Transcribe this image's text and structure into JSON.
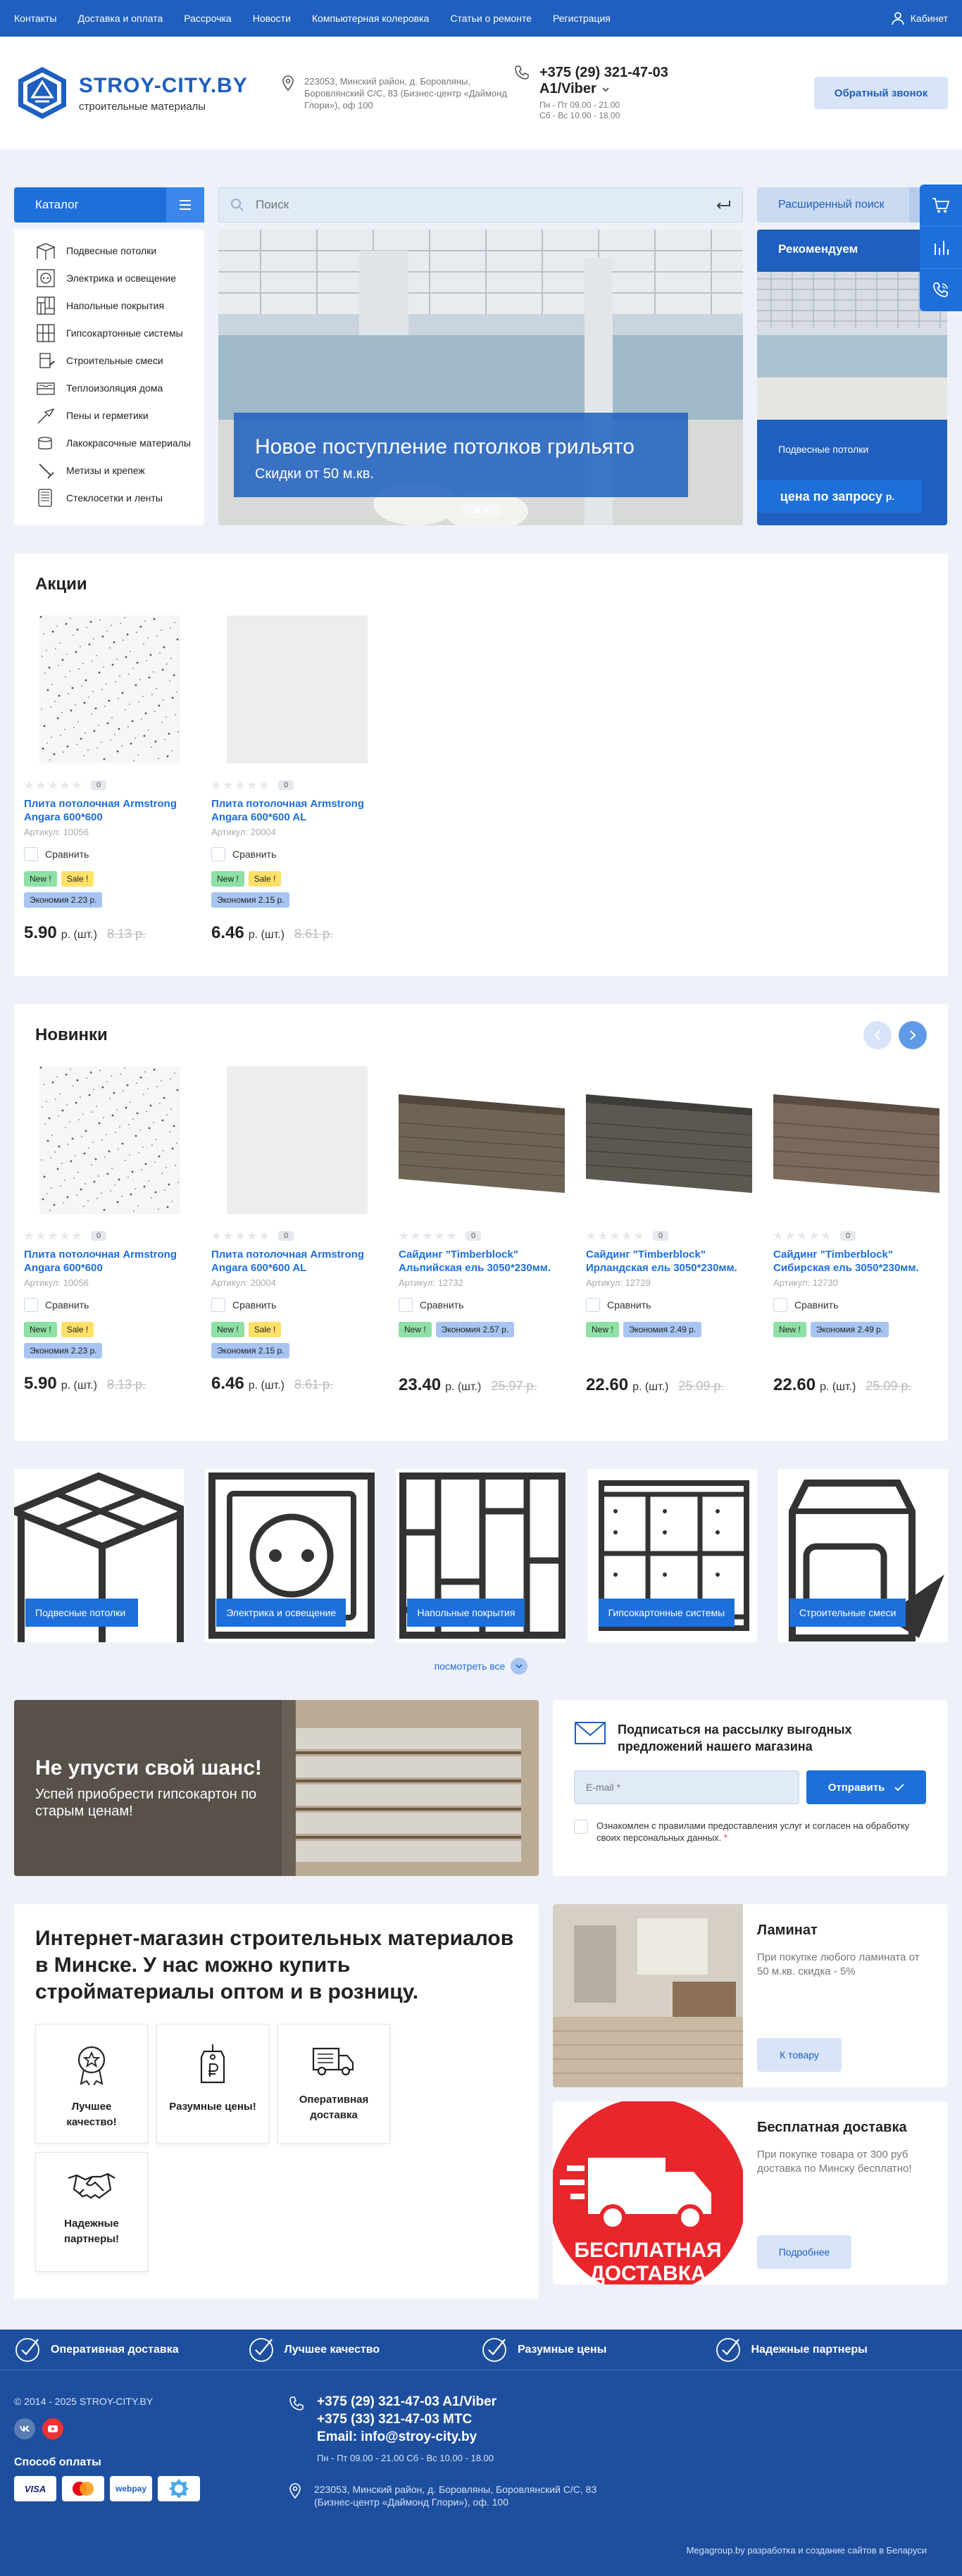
{
  "topbar": {
    "links": [
      "Контакты",
      "Доставка и оплата",
      "Рассрочка",
      "Новости",
      "Компьютерная колеровка",
      "Статьи о ремонте",
      "Регистрация"
    ],
    "cabinet": "Кабинет"
  },
  "header": {
    "logo_title": "STROY-CITY.BY",
    "logo_sub": "строительные материалы",
    "address": "223053, Минский район, д. Боровляны, Боровлянский С/С, 83 (Бизнес-центр «Даймонд Глори»), оф 100",
    "phone": "+375 (29) 321-47-03",
    "phone_sub": "A1/Viber",
    "hours_1": "Пн - Пт 09.00 - 21.00",
    "hours_2": "Сб - Вс 10.00 - 18.00",
    "callback": "Обратный звонок"
  },
  "search": {
    "catalog": "Каталог",
    "placeholder": "Поиск",
    "advanced": "Расширенный поиск"
  },
  "catalog_items": [
    {
      "label": "Подвесные потолки",
      "icon": "ceiling-icon"
    },
    {
      "label": "Электрика и освещение",
      "icon": "socket-icon"
    },
    {
      "label": "Напольные покрытия",
      "icon": "floor-icon"
    },
    {
      "label": "Гипсокартонные системы",
      "icon": "drywall-icon"
    },
    {
      "label": "Строительные смеси",
      "icon": "mix-icon"
    },
    {
      "label": "Теплоизоляция дома",
      "icon": "insulation-icon"
    },
    {
      "label": "Пены и герметики",
      "icon": "foam-icon"
    },
    {
      "label": "Лакокрасочные материалы",
      "icon": "paint-icon"
    },
    {
      "label": "Метизы и крепеж",
      "icon": "hardware-icon"
    },
    {
      "label": "Стеклосетки и ленты",
      "icon": "mesh-icon"
    }
  ],
  "slider": {
    "title": "Новое поступление потолков грильято",
    "subtitle": "Скидки от 50 м.кв."
  },
  "recommend": {
    "title": "Рекомендуем",
    "name": "Подвесные потолки",
    "price": "цена по запросу",
    "currency": "р."
  },
  "compare_label": "Сравнить",
  "sale": {
    "title": "Акции",
    "products": [
      {
        "name": "Плита потолочная Armstrong Angara 600*600",
        "art_label": "Артикул:",
        "art": "10056",
        "reviews": "0",
        "badges": [
          "New !",
          "Sale !"
        ],
        "eco": "Экономия 2.23 р.",
        "price": "5.90",
        "unit": "р. (шт.)",
        "old": "8.13 р."
      },
      {
        "name": "Плита потолочная Armstrong Angara 600*600 AL",
        "art_label": "Артикул:",
        "art": "20004",
        "reviews": "0",
        "badges": [
          "New !",
          "Sale !"
        ],
        "eco": "Экономия 2.15 р.",
        "price": "6.46",
        "unit": "р. (шт.)",
        "old": "8.61 р."
      }
    ]
  },
  "new": {
    "title": "Новинки",
    "products": [
      {
        "name": "Плита потолочная Armstrong Angara 600*600",
        "art_label": "Артикул:",
        "art": "10056",
        "reviews": "0",
        "badges": [
          "New !",
          "Sale !"
        ],
        "eco": "Экономия 2.23 р.",
        "price": "5.90",
        "unit": "р. (шт.)",
        "old": "8.13 р."
      },
      {
        "name": "Плита потолочная Armstrong Angara 600*600 AL",
        "art_label": "Артикул:",
        "art": "20004",
        "reviews": "0",
        "badges": [
          "New !",
          "Sale !"
        ],
        "eco": "Экономия 2.15 р.",
        "price": "6.46",
        "unit": "р. (шт.)",
        "old": "8.61 р."
      },
      {
        "name": "Сайдинг \"Timberblock\" Альпийская ель 3050*230мм.",
        "art_label": "Артикул:",
        "art": "12732",
        "reviews": "0",
        "badges": [
          "New !"
        ],
        "eco": "Экономия 2.57 р.",
        "price": "23.40",
        "unit": "р. (шт.)",
        "old": "25.97 р."
      },
      {
        "name": "Сайдинг \"Timberblock\" Ирландская ель 3050*230мм.",
        "art_label": "Артикул:",
        "art": "12729",
        "reviews": "0",
        "badges": [
          "New !"
        ],
        "eco": "Экономия 2.49 р.",
        "price": "22.60",
        "unit": "р. (шт.)",
        "old": "25.09 р."
      },
      {
        "name": "Сайдинг \"Timberblock\" Сибирская ель 3050*230мм.",
        "art_label": "Артикул:",
        "art": "12730",
        "reviews": "0",
        "badges": [
          "New !"
        ],
        "eco": "Экономия 2.49 р.",
        "price": "22.60",
        "unit": "р. (шт.)",
        "old": "25.09 р."
      }
    ]
  },
  "categories": [
    "Подвесные потолки",
    "Электрика и освещение",
    "Напольные покрытия",
    "Гипсокартонные системы",
    "Строительные смеси"
  ],
  "see_all": "посмотреть все",
  "promo": {
    "title": "Не упусти свой шанс!",
    "subtitle": "Успей приобрести гипсокартон по старым ценам!"
  },
  "subscribe": {
    "title": "Подписаться на рассылку выгодных предложений нашего магазина",
    "placeholder": "E-mail *",
    "button": "Отправить",
    "agree": "Ознакомлен с правилами предоставления услуг и согласен на обработку своих персональных данных.",
    "agree_req": "*"
  },
  "about": {
    "title": "Интернет-магазин строительных материалов в Минске. У нас можно купить стройматериалы оптом и в розницу.",
    "features": [
      "Лучшее качество!",
      "Разумные цены!",
      "Оперативная доставка",
      "Надежные партнеры!"
    ]
  },
  "laminate": {
    "title": "Ламинат",
    "desc": "При покупке любого ламината от 50 м.кв. скидка - 5%",
    "button": "К товару"
  },
  "delivery": {
    "title": "Бесплатная доставка",
    "desc": "При покупке товара от 300 руб доставка по Минску бесплатно!",
    "button": "Подробнее",
    "img_text_1": "БЕСПЛАТНАЯ",
    "img_text_2": "ДОСТАВКА"
  },
  "footer": {
    "features": [
      "Оперативная доставка",
      "Лучшее качество",
      "Разумные цены",
      "Надежные партнеры"
    ],
    "copyright": "© 2014 - 2025 STROY-CITY.BY",
    "payment_title": "Способ оплаты",
    "payments": [
      "VISA",
      "MC",
      "webpay",
      "Raschet"
    ],
    "phone_1": "+375 (29) 321-47-03 A1/Viber",
    "phone_2": "+375 (33) 321-47-03 МТС",
    "email": "Email: info@stroy-city.by",
    "hours": "Пн - Пт 09.00 - 21.00 Сб - Вс 10.00 - 18.00",
    "address": "223053, Минский район, д. Боровляны, Боровлянский С/С, 83 (Бизнес-центр «Даймонд Глори»), оф. 100",
    "developer": "Megagroup.by разработка и создание сайтов в Беларуси"
  }
}
